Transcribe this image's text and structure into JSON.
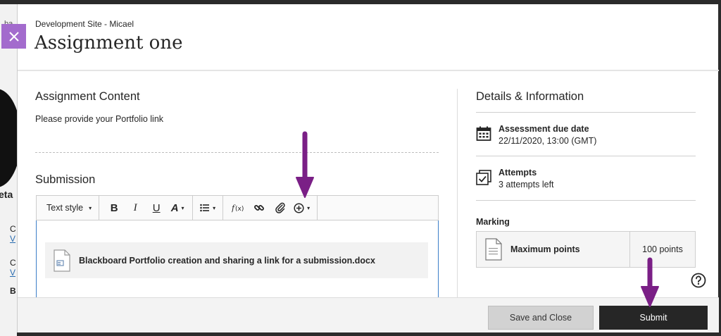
{
  "header": {
    "site_name": "Development Site - Micael",
    "title": "Assignment one"
  },
  "content": {
    "section_title": "Assignment Content",
    "instructions": "Please provide your Portfolio link"
  },
  "submission": {
    "section_title": "Submission",
    "toolbar": {
      "text_style": "Text style",
      "bold": "B",
      "italic": "I",
      "underline": "U",
      "font_color": "A",
      "caret": "▾"
    },
    "attachment_name": "Blackboard Portfolio creation and sharing a link for a submission.docx"
  },
  "details": {
    "title": "Details & Information",
    "due_label": "Assessment due date",
    "due_value": "22/11/2020, 13:00 (GMT)",
    "attempts_label": "Attempts",
    "attempts_value": "3 attempts left",
    "marking_label": "Marking",
    "max_points_label": "Maximum points",
    "max_points_value": "100 points"
  },
  "footer": {
    "save_label": "Save and Close",
    "submit_label": "Submit"
  },
  "colors": {
    "close_button": "#a36bcd",
    "annotation_arrow": "#7a1f86",
    "submit_button": "#262626",
    "editor_focus": "#3c7ec8"
  },
  "background_fragments": [
    "ba",
    "eta",
    "C",
    "V",
    "C",
    "V",
    "B"
  ]
}
